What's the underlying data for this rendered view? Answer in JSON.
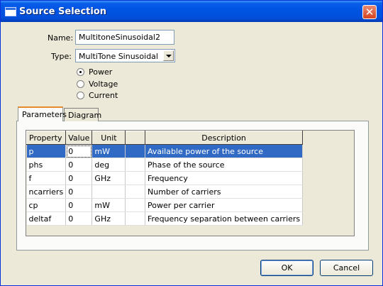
{
  "window": {
    "title": "Source Selection",
    "close_glyph": "✕"
  },
  "form": {
    "name_label": "Name:",
    "name_value": "MultitoneSinusoidal2",
    "type_label": "Type:",
    "type_value": "MultiTone Sinusoidal"
  },
  "radios": [
    {
      "label": "Power",
      "checked": true
    },
    {
      "label": "Voltage",
      "checked": false
    },
    {
      "label": "Current",
      "checked": false
    }
  ],
  "tabs": [
    {
      "label": "Parameters",
      "active": true
    },
    {
      "label": "Diagram",
      "active": false
    }
  ],
  "table": {
    "headers": [
      "Property",
      "Value",
      "Unit",
      "",
      "Description"
    ],
    "rows": [
      [
        "p",
        "0",
        "mW",
        "",
        "Available power of the source"
      ],
      [
        "phs",
        "0",
        "deg",
        "",
        "Phase of the source"
      ],
      [
        "f",
        "0",
        "GHz",
        "",
        "Frequency"
      ],
      [
        "ncarriers",
        "0",
        "",
        "",
        "Number of carriers"
      ],
      [
        "cp",
        "0",
        "mW",
        "",
        "Power per carrier"
      ],
      [
        "deltaf",
        "0",
        "GHz",
        "",
        "Frequency separation between carriers"
      ]
    ],
    "selected_row": 0
  },
  "buttons": {
    "ok": "OK",
    "cancel": "Cancel"
  }
}
